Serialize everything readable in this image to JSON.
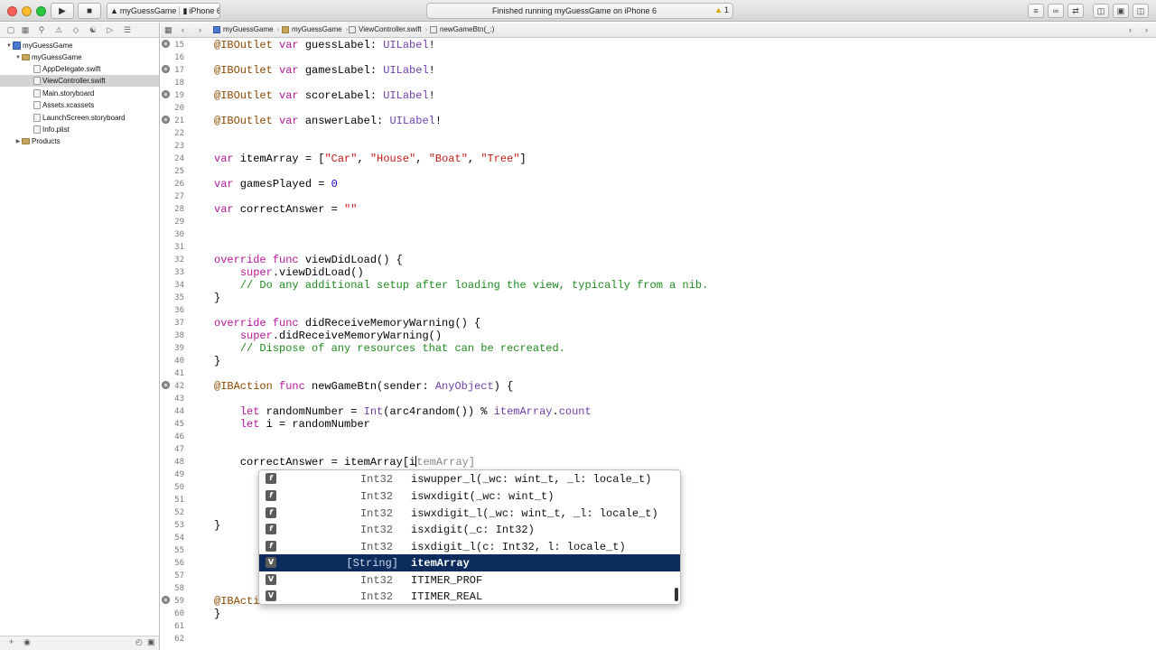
{
  "toolbar": {
    "scheme_project": "myGuessGame",
    "scheme_device": "iPhone 6",
    "status_text": "Finished running myGuessGame on iPhone 6",
    "warning_count": "1"
  },
  "navigator": {
    "items": [
      {
        "label": "myGuessGame",
        "kind": "project"
      },
      {
        "label": "myGuessGame",
        "kind": "folder"
      },
      {
        "label": "AppDelegate.swift",
        "kind": "file"
      },
      {
        "label": "ViewController.swift",
        "kind": "file"
      },
      {
        "label": "Main.storyboard",
        "kind": "file"
      },
      {
        "label": "Assets.xcassets",
        "kind": "file"
      },
      {
        "label": "LaunchScreen.storyboard",
        "kind": "file"
      },
      {
        "label": "Info.plist",
        "kind": "file"
      },
      {
        "label": "Products",
        "kind": "folder"
      }
    ]
  },
  "jumpbar": {
    "crumbs": [
      "myGuessGame",
      "myGuessGame",
      "ViewController.swift",
      "newGameBtn(_:)"
    ]
  },
  "editor": {
    "line_numbers": [
      "15",
      "16",
      "17",
      "18",
      "19",
      "20",
      "21",
      "22",
      "23",
      "24",
      "25",
      "26",
      "27",
      "28",
      "29",
      "30",
      "31",
      "32",
      "33",
      "34",
      "35",
      "36",
      "37",
      "38",
      "39",
      "40",
      "41",
      "42",
      "43",
      "44",
      "45",
      "46",
      "47",
      "48",
      "49",
      "50",
      "51",
      "52",
      "53",
      "54",
      "55",
      "56",
      "57",
      "58",
      "59",
      "60",
      "61",
      "62"
    ],
    "code": {
      "l15": [
        "@IBOutlet",
        " ",
        "var",
        " guessLabel: ",
        "UILabel",
        "!"
      ],
      "l17": [
        "@IBOutlet",
        " ",
        "var",
        " gamesLabel: ",
        "UILabel",
        "!"
      ],
      "l19": [
        "@IBOutlet",
        " ",
        "var",
        " scoreLabel: ",
        "UILabel",
        "!"
      ],
      "l21": [
        "@IBOutlet",
        " ",
        "var",
        " answerLabel: ",
        "UILabel",
        "!"
      ],
      "l24": [
        "var",
        " itemArray = [",
        "\"Car\"",
        ", ",
        "\"House\"",
        ", ",
        "\"Boat\"",
        ", ",
        "\"Tree\"",
        "]"
      ],
      "l26": [
        "var",
        " gamesPlayed = ",
        "0"
      ],
      "l28": [
        "var",
        " correctAnswer = ",
        "\"\""
      ],
      "l32": [
        "override",
        " ",
        "func",
        " viewDidLoad() {"
      ],
      "l33": [
        "    ",
        "super",
        ".viewDidLoad()"
      ],
      "l34": [
        "    ",
        "// Do any additional setup after loading the view, typically from a nib."
      ],
      "l35": [
        "}"
      ],
      "l37": [
        "override",
        " ",
        "func",
        " didReceiveMemoryWarning() {"
      ],
      "l38": [
        "    ",
        "super",
        ".didReceiveMemoryWarning()"
      ],
      "l39": [
        "    ",
        "// Dispose of any resources that can be recreated."
      ],
      "l40": [
        "}"
      ],
      "l42": [
        "@IBAction",
        " ",
        "func",
        " newGameBtn(sender: ",
        "AnyObject",
        ") {"
      ],
      "l44": [
        "    ",
        "let",
        " randomNumber = ",
        "Int",
        "(arc4random()) % ",
        "itemArray",
        ".",
        "count"
      ],
      "l45": [
        "    ",
        "let",
        " i = randomNumber"
      ],
      "l48": [
        "    correctAnswer = itemArray[",
        "i",
        "temArray",
        "]"
      ],
      "l53": [
        "}"
      ],
      "l59": [
        "@IBActi"
      ],
      "l60": [
        "}"
      ]
    }
  },
  "completion": {
    "items": [
      {
        "badge": "f",
        "type": "Int32",
        "text": "iswupper_l(_wc: wint_t, _l: locale_t)"
      },
      {
        "badge": "f",
        "type": "Int32",
        "text": "iswxdigit(_wc: wint_t)"
      },
      {
        "badge": "f",
        "type": "Int32",
        "text": "iswxdigit_l(_wc: wint_t, _l: locale_t)"
      },
      {
        "badge": "f",
        "type": "Int32",
        "text": "isxdigit(_c: Int32)"
      },
      {
        "badge": "f",
        "type": "Int32",
        "text": "isxdigit_l(c: Int32, l: locale_t)"
      },
      {
        "badge": "V",
        "type": "[String]",
        "text": "itemArray",
        "selected": true
      },
      {
        "badge": "V",
        "type": "Int32",
        "text": "ITIMER_PROF"
      },
      {
        "badge": "V",
        "type": "Int32",
        "text": "ITIMER_REAL"
      }
    ]
  },
  "colors": {
    "keyword": "#b5169a",
    "string": "#c41a16",
    "number": "#1c00cf",
    "comment": "#1f8a1f",
    "type": "#6f3fa8",
    "selection": "#0c2c5e"
  },
  "icons": {
    "run": "play-icon",
    "stop": "stop-icon",
    "warning": "warning-icon"
  }
}
